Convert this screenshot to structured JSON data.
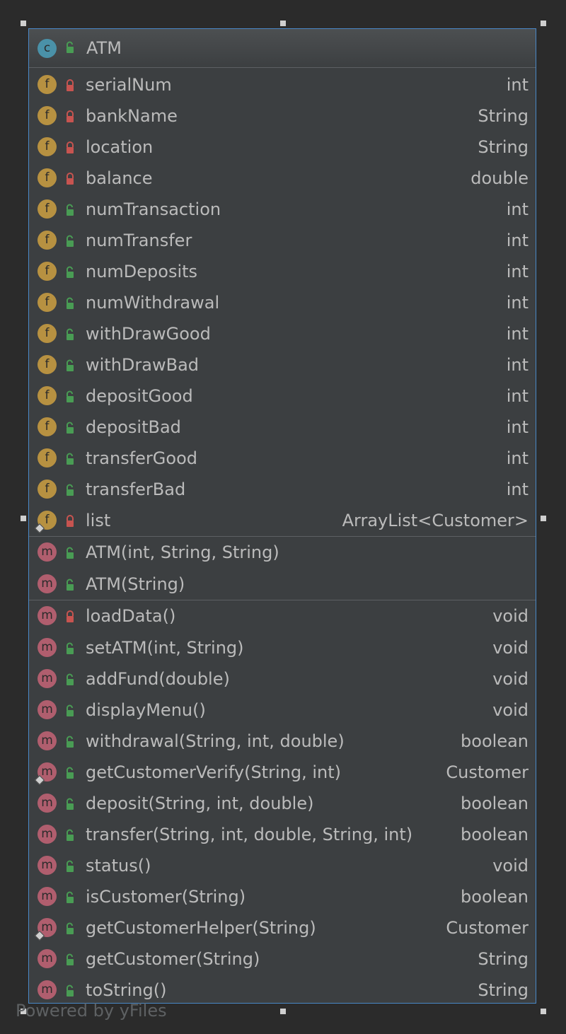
{
  "class_box": {
    "kind_letter": "c",
    "name": "ATM",
    "visibility": "public"
  },
  "fields": [
    {
      "kind": "f",
      "visibility": "private",
      "name": "serialNum",
      "type": "int"
    },
    {
      "kind": "f",
      "visibility": "private",
      "name": "bankName",
      "type": "String"
    },
    {
      "kind": "f",
      "visibility": "private",
      "name": "location",
      "type": "String"
    },
    {
      "kind": "f",
      "visibility": "private",
      "name": "balance",
      "type": "double"
    },
    {
      "kind": "f",
      "visibility": "public",
      "name": "numTransaction",
      "type": "int"
    },
    {
      "kind": "f",
      "visibility": "public",
      "name": "numTransfer",
      "type": "int"
    },
    {
      "kind": "f",
      "visibility": "public",
      "name": "numDeposits",
      "type": "int"
    },
    {
      "kind": "f",
      "visibility": "public",
      "name": "numWithdrawal",
      "type": "int"
    },
    {
      "kind": "f",
      "visibility": "public",
      "name": "withDrawGood",
      "type": "int"
    },
    {
      "kind": "f",
      "visibility": "public",
      "name": "withDrawBad",
      "type": "int"
    },
    {
      "kind": "f",
      "visibility": "public",
      "name": "depositGood",
      "type": "int"
    },
    {
      "kind": "f",
      "visibility": "public",
      "name": "depositBad",
      "type": "int"
    },
    {
      "kind": "f",
      "visibility": "public",
      "name": "transferGood",
      "type": "int"
    },
    {
      "kind": "f",
      "visibility": "public",
      "name": "transferBad",
      "type": "int"
    },
    {
      "kind": "f",
      "visibility": "private",
      "name": "list",
      "type": "ArrayList<Customer>"
    }
  ],
  "constructors": [
    {
      "kind": "m",
      "visibility": "public",
      "name": "ATM(int, String, String)",
      "type": ""
    },
    {
      "kind": "m",
      "visibility": "public",
      "name": "ATM(String)",
      "type": ""
    }
  ],
  "methods": [
    {
      "kind": "m",
      "visibility": "private",
      "name": "loadData()",
      "type": "void"
    },
    {
      "kind": "m",
      "visibility": "public",
      "name": "setATM(int, String)",
      "type": "void"
    },
    {
      "kind": "m",
      "visibility": "public",
      "name": "addFund(double)",
      "type": "void"
    },
    {
      "kind": "m",
      "visibility": "public",
      "name": "displayMenu()",
      "type": "void"
    },
    {
      "kind": "m",
      "visibility": "public",
      "name": "withdrawal(String, int, double)",
      "type": "boolean"
    },
    {
      "kind": "m",
      "visibility": "public",
      "name": "getCustomerVerify(String, int)",
      "type": "Customer"
    },
    {
      "kind": "m",
      "visibility": "public",
      "name": "deposit(String, int, double)",
      "type": "boolean"
    },
    {
      "kind": "m",
      "visibility": "public",
      "name": "transfer(String, int, double, String, int)",
      "type": "boolean"
    },
    {
      "kind": "m",
      "visibility": "public",
      "name": "status()",
      "type": "void"
    },
    {
      "kind": "m",
      "visibility": "public",
      "name": "isCustomer(String)",
      "type": "boolean"
    },
    {
      "kind": "m",
      "visibility": "public",
      "name": "getCustomerHelper(String)",
      "type": "Customer"
    },
    {
      "kind": "m",
      "visibility": "public",
      "name": "getCustomer(String)",
      "type": "String"
    },
    {
      "kind": "m",
      "visibility": "public",
      "name": "toString()",
      "type": "String"
    }
  ],
  "watermark": "Powered by yFiles",
  "colors": {
    "background": "#2b2b2b",
    "panel": "#3c3f41",
    "selection_border": "#4a88c7",
    "field_badge": "#b79141",
    "method_badge": "#b05e6e",
    "class_badge": "#4a91a8",
    "private_lock": "#c75450",
    "public_lock": "#499c54",
    "text": "#bbbbbb"
  }
}
